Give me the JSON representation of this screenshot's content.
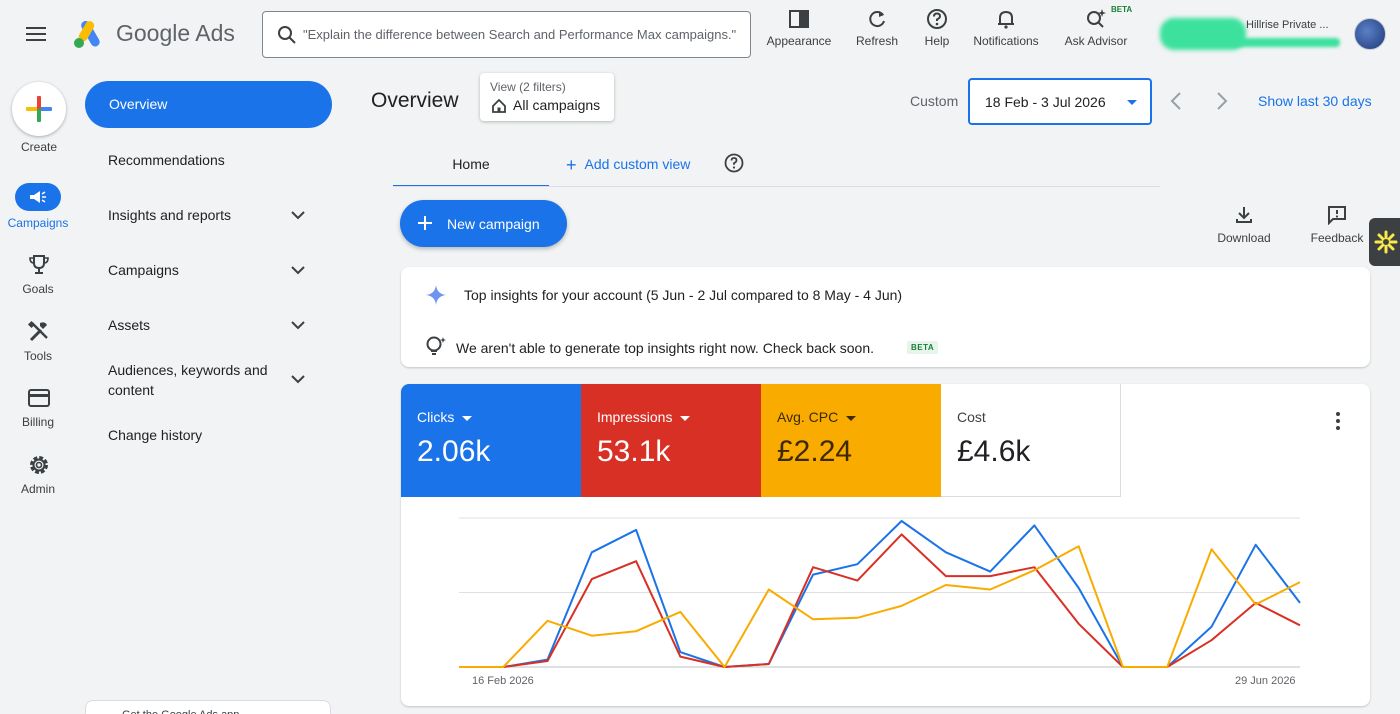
{
  "header": {
    "logo_text": "Google Ads",
    "search_placeholder": "\"Explain the difference between Search and Performance Max campaigns.\"",
    "tools": [
      {
        "label": "Appearance",
        "icon": "appearance-icon"
      },
      {
        "label": "Refresh",
        "icon": "refresh-icon"
      },
      {
        "label": "Help",
        "icon": "help-icon"
      },
      {
        "label": "Notifications",
        "icon": "bell-icon"
      },
      {
        "label": "Ask Advisor",
        "icon": "advisor-icon",
        "badge": "BETA"
      }
    ],
    "account_name": "Hillrise Private ..."
  },
  "rail": {
    "create_label": "Create",
    "items": [
      {
        "label": "Campaigns",
        "icon": "megaphone-icon",
        "active": true
      },
      {
        "label": "Goals",
        "icon": "trophy-icon"
      },
      {
        "label": "Tools",
        "icon": "tools-icon"
      },
      {
        "label": "Billing",
        "icon": "card-icon"
      },
      {
        "label": "Admin",
        "icon": "gear-icon"
      }
    ]
  },
  "sidebar": {
    "items": [
      {
        "label": "Overview",
        "active": true
      },
      {
        "label": "Recommendations"
      },
      {
        "label": "Insights and reports",
        "expandable": true
      },
      {
        "label": "Campaigns",
        "expandable": true
      },
      {
        "label": "Assets",
        "expandable": true
      },
      {
        "label": "Audiences, keywords and content",
        "expandable": true
      },
      {
        "label": "Change history"
      }
    ],
    "promo": "Get the Google Ads app"
  },
  "main": {
    "title": "Overview",
    "view_label": "View (2 filters)",
    "view_value": "All campaigns",
    "date_mode": "Custom",
    "date_range": "18 Feb - 3 Jul 2026",
    "show_last": "Show last 30 days",
    "tabs": [
      {
        "label": "Home",
        "active": true
      }
    ],
    "add_custom_view": "Add custom view",
    "new_campaign": "New campaign",
    "download": "Download",
    "feedback": "Feedback"
  },
  "insights": {
    "title": "Top insights for your account (5 Jun - 2 Jul compared to 8 May - 4 Jun)",
    "message": "We aren't able to generate top insights right now. Check back soon.",
    "badge": "BETA"
  },
  "metrics": {
    "tiles": [
      {
        "label": "Clicks",
        "value": "2.06k",
        "color": "#1a73e8",
        "dropdown": true
      },
      {
        "label": "Impressions",
        "value": "53.1k",
        "color": "#d93025",
        "dropdown": true
      },
      {
        "label": "Avg. CPC",
        "value": "£2.24",
        "color": "#f9ab00",
        "dropdown": true
      },
      {
        "label": "Cost",
        "value": "£4.6k",
        "color": "#ffffff",
        "dropdown": false
      }
    ]
  },
  "chart_data": {
    "type": "line",
    "x_start_label": "16 Feb 2026",
    "x_end_label": "29 Jun 2026",
    "x": [
      1,
      2,
      3,
      4,
      5,
      6,
      7,
      8,
      9,
      10,
      11,
      12,
      13,
      14,
      15,
      16,
      17,
      18,
      19,
      20
    ],
    "ylim": [
      0,
      100
    ],
    "grid": true,
    "series": [
      {
        "color": "#1a73e8",
        "values": [
          0,
          0,
          5,
          77,
          92,
          10,
          0,
          2,
          62,
          69,
          98,
          77,
          64,
          95,
          53,
          0,
          0,
          27,
          82,
          43
        ]
      },
      {
        "color": "#d93025",
        "values": [
          0,
          0,
          4,
          59,
          71,
          7,
          0,
          2,
          67,
          58,
          89,
          61,
          61,
          67,
          29,
          0,
          0,
          18,
          43,
          28
        ]
      },
      {
        "color": "#f9ab00",
        "values": [
          0,
          0,
          31,
          21,
          24,
          37,
          0,
          52,
          32,
          33,
          41,
          55,
          52,
          65,
          81,
          0,
          0,
          79,
          42,
          57
        ]
      }
    ]
  },
  "colors": {
    "accent": "#1a73e8",
    "background": "#f1f3f4"
  }
}
